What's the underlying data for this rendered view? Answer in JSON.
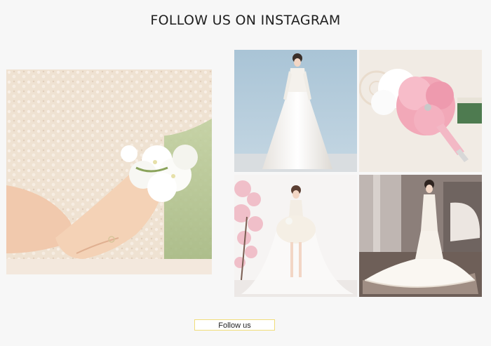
{
  "instagram": {
    "heading": "FOLLOW US ON INSTAGRAM",
    "follow_label": "Follow us",
    "accent_border_color": "#f0dd7a"
  },
  "photos": [
    {
      "subject": "bridal-wrist-corsage"
    },
    {
      "subject": "satin-wedding-gown"
    },
    {
      "subject": "pink-rose-bouquet"
    },
    {
      "subject": "short-lace-dress-with-blossoms"
    },
    {
      "subject": "mermaid-gown-with-train"
    }
  ]
}
